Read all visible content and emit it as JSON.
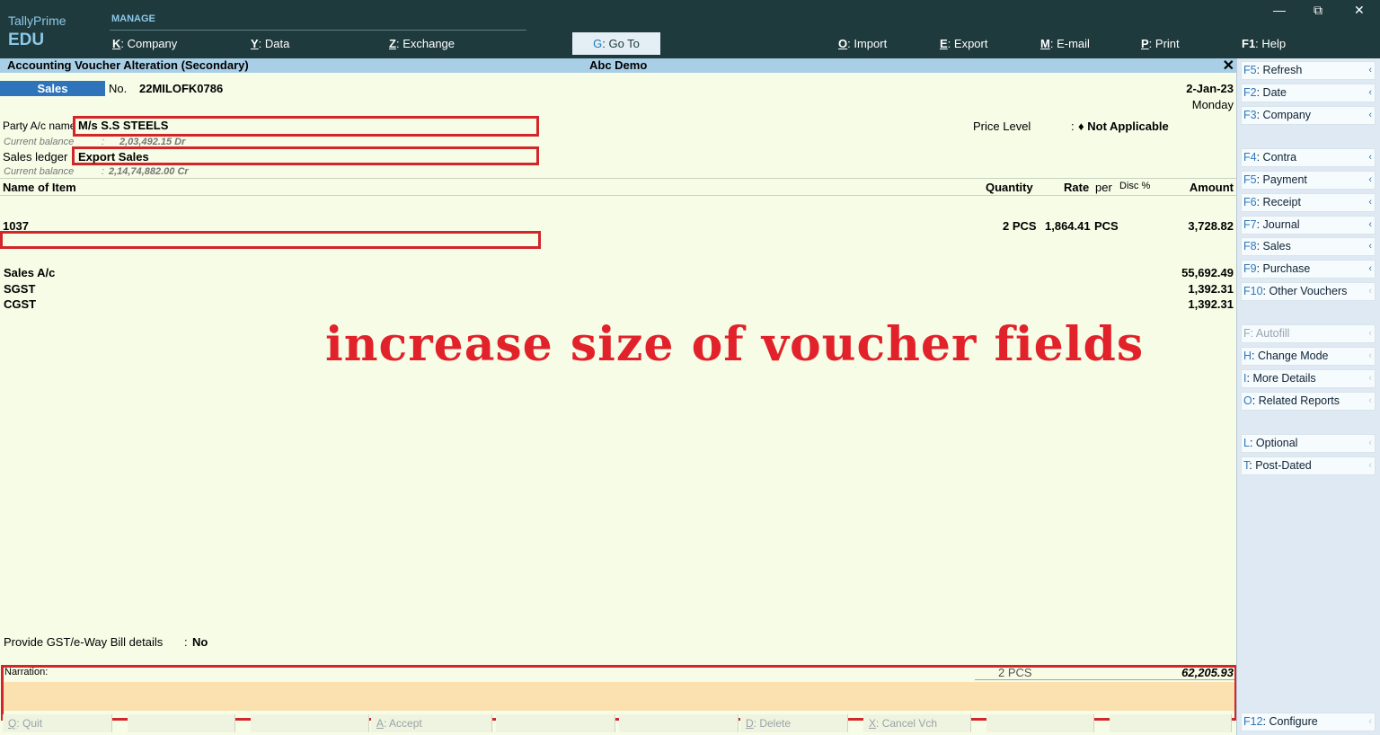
{
  "brand": {
    "line1": "TallyPrime",
    "line2": "EDU"
  },
  "topbar": {
    "section": "MANAGE",
    "menu": [
      {
        "key": "K",
        "label": "Company"
      },
      {
        "key": "Y",
        "label": "Data"
      },
      {
        "key": "Z",
        "label": "Exchange"
      },
      {
        "key": "G",
        "label": "Go To"
      },
      {
        "key": "O",
        "label": "Import"
      },
      {
        "key": "E",
        "label": "Export"
      },
      {
        "key": "M",
        "label": "E-mail"
      },
      {
        "key": "P",
        "label": "Print"
      },
      {
        "key": "F1",
        "label": "Help"
      }
    ],
    "window": {
      "minimize": "—",
      "restore": "⧉",
      "close": "✕"
    }
  },
  "title": {
    "left": "Accounting Voucher Alteration (Secondary)",
    "center": "Abc Demo",
    "close": "✕"
  },
  "voucher": {
    "type": "Sales",
    "no_label": "No.",
    "number": "22MILOFK0786",
    "date": "2-Jan-23",
    "day": "Monday",
    "party_label": "Party A/c name",
    "party_value": "M/s S.S STEELS",
    "party_balance_label": "Current balance",
    "party_balance": "2,03,492.15 Dr",
    "ledger_label": "Sales ledger",
    "ledger_value": "Export Sales",
    "ledger_balance_label": "Current balance",
    "ledger_balance": "2,14,74,882.00 Cr",
    "price_level_label": "Price Level",
    "price_level_sep": ":",
    "price_level_value": "♦ Not Applicable",
    "columns": {
      "item": "Name of Item",
      "qty": "Quantity",
      "rate": "Rate",
      "per": "per",
      "disc": "Disc %",
      "amount": "Amount"
    },
    "items": [
      {
        "name": "1037",
        "qty": "2 PCS",
        "rate": "1,864.41",
        "per": "PCS",
        "amount": "3,728.82"
      }
    ],
    "ledgers": [
      {
        "name": "Sales A/c",
        "amount": "55,692.49"
      },
      {
        "name": "SGST",
        "amount": "1,392.31"
      },
      {
        "name": "CGST",
        "amount": "1,392.31"
      }
    ],
    "gst_label": "Provide GST/e-Way Bill details",
    "gst_sep": ":",
    "gst_value": "No",
    "narration_label": "Narration:",
    "total_qty": "2 PCS",
    "total_amount": "62,205.93"
  },
  "annotation": "increase size of voucher fields",
  "bottom_buttons": [
    {
      "key": "Q",
      "label": "Quit"
    },
    {
      "key": "",
      "label": ""
    },
    {
      "key": "",
      "label": ""
    },
    {
      "key": "A",
      "label": "Accept"
    },
    {
      "key": "",
      "label": ""
    },
    {
      "key": "",
      "label": ""
    },
    {
      "key": "D",
      "label": "Delete"
    },
    {
      "key": "X",
      "label": "Cancel Vch"
    },
    {
      "key": "",
      "label": ""
    },
    {
      "key": "",
      "label": ""
    }
  ],
  "right_panel": [
    {
      "key": "F5",
      "label": "Refresh",
      "disabled": false
    },
    {
      "key": "F2",
      "label": "Date",
      "disabled": false
    },
    {
      "key": "F3",
      "label": "Company",
      "disabled": false
    },
    {
      "key": "F4",
      "label": "Contra",
      "disabled": false
    },
    {
      "key": "F5",
      "label": "Payment",
      "disabled": false
    },
    {
      "key": "F6",
      "label": "Receipt",
      "disabled": false
    },
    {
      "key": "F7",
      "label": "Journal",
      "disabled": false
    },
    {
      "key": "F8",
      "label": "Sales",
      "disabled": false
    },
    {
      "key": "F9",
      "label": "Purchase",
      "disabled": false
    },
    {
      "key": "F10",
      "label": "Other Vouchers",
      "disabled": false
    },
    {
      "key": "F",
      "label": "Autofill",
      "disabled": true
    },
    {
      "key": "H",
      "label": "Change Mode",
      "disabled": false
    },
    {
      "key": "I",
      "label": "More Details",
      "disabled": false
    },
    {
      "key": "O",
      "label": "Related Reports",
      "disabled": false
    },
    {
      "key": "L",
      "label": "Optional",
      "disabled": false
    },
    {
      "key": "T",
      "label": "Post-Dated",
      "disabled": false
    },
    {
      "key": "F12",
      "label": "Configure",
      "disabled": false
    }
  ],
  "colors": {
    "accent": "#2f74bb",
    "topbar": "#1f3a3d",
    "highlight": "#d3262b",
    "background": "#f6fce6"
  }
}
